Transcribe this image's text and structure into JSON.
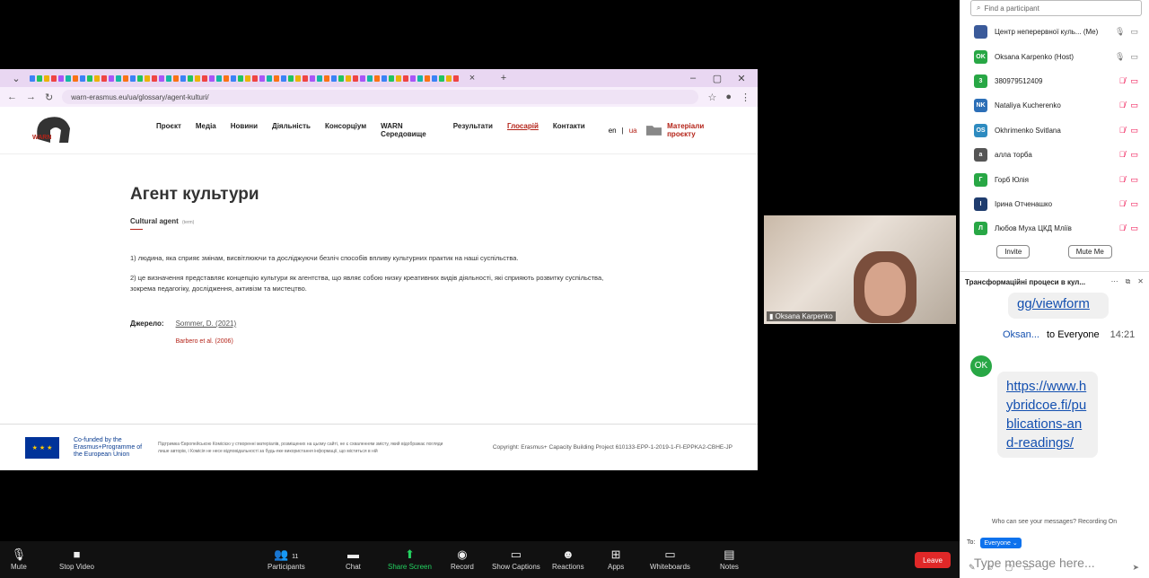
{
  "browser": {
    "tab_close": "×",
    "new_tab": "+",
    "minimize": "–",
    "restore": "▢",
    "close": "✕",
    "url": "warn-erasmus.eu/ua/glossary/agent-kulturi/"
  },
  "site": {
    "logo_text": "WARN",
    "nav": [
      "Проєкт",
      "Медіа",
      "Новини",
      "Діяльність",
      "Консорціум",
      "WARN Середовище",
      "Результати",
      "Глосарій",
      "Контакти"
    ],
    "active_nav_index": 7,
    "lang_en": "en",
    "lang_sep": "|",
    "lang_ua": "ua",
    "materials": "Матеріали проєкту",
    "title": "Агент культури",
    "subtitle": "Cultural agent",
    "subtitle_tag": "(term)",
    "definition_1": "1) людина, яка сприяє змінам, висвітлюючи та досліджуючи безліч способів впливу культурних практик на наші суспільства.",
    "definition_2": "2) це визначення представляє концепцію культури як агентства, що являє собою низку креативних видів діяльності, які сприяють розвитку суспільства, зокрема педагогіку, дослідження, активізм та мистецтво.",
    "sources_label": "Джерело:",
    "source_1": "Sommer, D. (2021)",
    "source_2": "Barbero et al. (2006)",
    "eu_text": "Co-funded by the Erasmus+Programme of the European Union",
    "eu_disclaimer": "Підтримка Європейською Комісією у створенні матеріалів, розміщених на цьому сайті, не є схваленням змісту, який відображає погляди лише авторів, і Комісія не несе відповідальності за будь-яке використання інформації, що міститься в ній",
    "copyright": "Copyright: Erasmus+ Capacity Building Project 610133-EPP-1-2019-1-FI-EPPKA2-CBHE-JP"
  },
  "video": {
    "name": "Oksana Karpenko"
  },
  "participants_panel": {
    "search_placeholder": "Find a participant",
    "participants": [
      {
        "initials": "",
        "name": "Центр неперервної куль... (Me)",
        "color": "#3a5a9a",
        "muted": false
      },
      {
        "initials": "OK",
        "name": "Oksana Karpenko (Host)",
        "color": "#28a745",
        "muted": false
      },
      {
        "initials": "3",
        "name": "380979512409",
        "color": "#28a745",
        "muted": true
      },
      {
        "initials": "NK",
        "name": "Nataliya Kucherenko",
        "color": "#2c6fb7",
        "muted": true
      },
      {
        "initials": "OS",
        "name": "Okhrimenko Svitlana",
        "color": "#2e8bc0",
        "muted": true
      },
      {
        "initials": "а",
        "name": "алла торба",
        "color": "#555555",
        "muted": true
      },
      {
        "initials": "Г",
        "name": "Горб Юлія",
        "color": "#28a745",
        "muted": true
      },
      {
        "initials": "І",
        "name": "Ірина Отченашко",
        "color": "#1f3c6e",
        "muted": true
      },
      {
        "initials": "Л",
        "name": "Любов Муха ЦКД Мліїв",
        "color": "#28a745",
        "muted": true
      }
    ],
    "invite": "Invite",
    "mute_me": "Mute Me"
  },
  "chat": {
    "title": "Трансформаційні процеси в кул...",
    "prev_link_tail": "gg/viewform",
    "sender": "Oksan...",
    "to": "to Everyone",
    "time": "14:21",
    "avatar": "OK",
    "link": "https://www.hybridcoe.fi/publications-and-readings/",
    "who_can_see": "Who can see your messages? Recording On",
    "to_label": "To:",
    "recipient": "Everyone ⌄",
    "input_placeholder": "Type message here..."
  },
  "toolbar": {
    "mute": "Mute",
    "stop_video": "Stop Video",
    "participants": "Participants",
    "participants_count": "11",
    "chat": "Chat",
    "share_screen": "Share Screen",
    "record": "Record",
    "show_captions": "Show Captions",
    "reactions": "Reactions",
    "apps": "Apps",
    "whiteboards": "Whiteboards",
    "notes": "Notes",
    "leave": "Leave"
  }
}
